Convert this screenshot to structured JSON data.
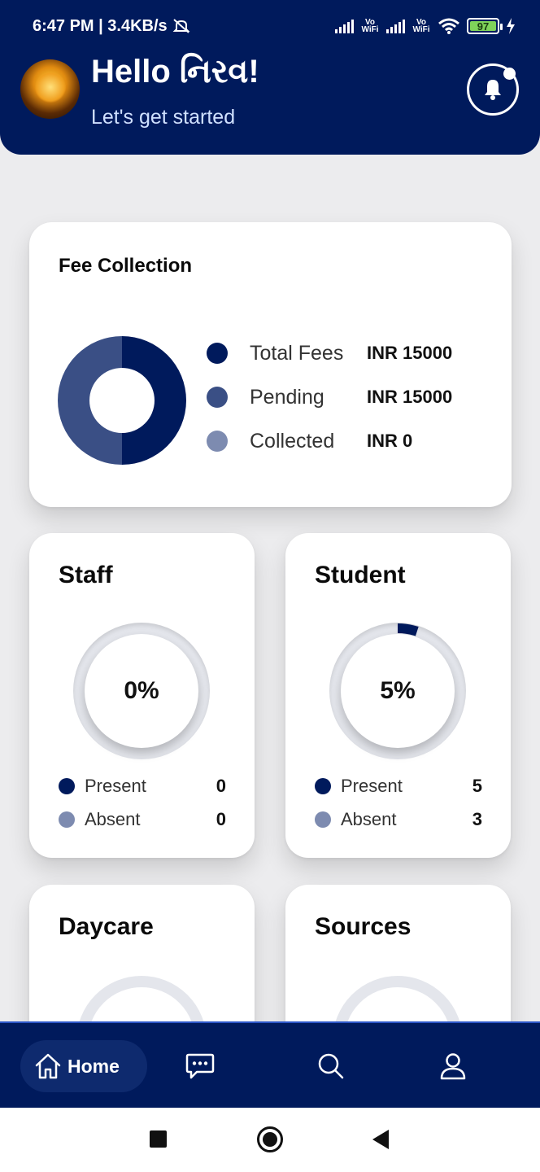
{
  "status_bar": {
    "time_speed": "6:47 PM | 3.4KB/s",
    "vowifi_1": "Vo WiFi",
    "vowifi_2": "Vo WiFi",
    "battery": "97"
  },
  "header": {
    "greeting": "Hello નિરવ!",
    "subtitle": "Let's get started",
    "has_notification": true
  },
  "fee_collection": {
    "title": "Fee Collection",
    "items": [
      {
        "label": "Total Fees",
        "value": "INR 15000",
        "color": "#001a5c"
      },
      {
        "label": "Pending",
        "value": "INR 15000",
        "color": "#3a4f85"
      },
      {
        "label": "Collected",
        "value": "INR 0",
        "color": "#7d8bb0"
      }
    ],
    "donut": [
      {
        "label": "Total Fees",
        "value": 15000,
        "color": "#001a5c"
      },
      {
        "label": "Pending",
        "value": 15000,
        "color": "#3a4f85"
      },
      {
        "label": "Collected",
        "value": 0,
        "color": "#7d8bb0"
      }
    ]
  },
  "staff": {
    "title": "Staff",
    "percent_label": "0%",
    "percent": 0,
    "present_label": "Present",
    "present_value": "0",
    "absent_label": "Absent",
    "absent_value": "0"
  },
  "student": {
    "title": "Student",
    "percent_label": "5%",
    "percent": 5,
    "present_label": "Present",
    "present_value": "5",
    "absent_label": "Absent",
    "absent_value": "3"
  },
  "daycare": {
    "title": "Daycare"
  },
  "sources": {
    "title": "Sources"
  },
  "bottom_nav": {
    "home_label": "Home"
  },
  "colors": {
    "primary": "#001a5c",
    "present_dot": "#001a5c",
    "absent_dot": "#7d8bb0"
  }
}
